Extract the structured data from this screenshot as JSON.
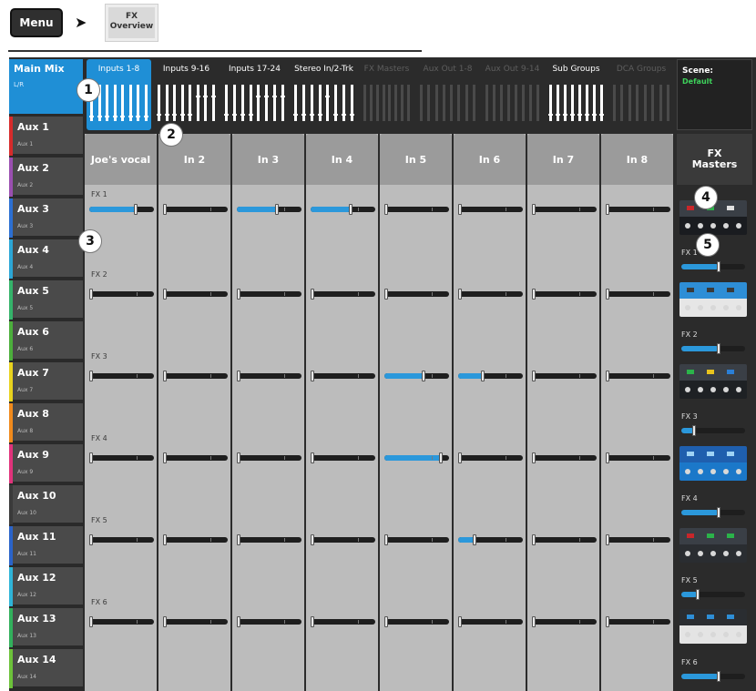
{
  "breadcrumb": {
    "menu": "Menu",
    "fx_line1": "FX",
    "fx_line2": "Overview"
  },
  "sidebar": {
    "main_mix": {
      "label": "Main Mix",
      "sub": "L/R"
    },
    "aux": [
      {
        "label": "Aux 1",
        "sub": "Aux 1",
        "color": "#d62b2b"
      },
      {
        "label": "Aux 2",
        "sub": "Aux 2",
        "color": "#9a4fb0"
      },
      {
        "label": "Aux 3",
        "sub": "Aux 3",
        "color": "#2c6fd2"
      },
      {
        "label": "Aux 4",
        "sub": "Aux 4",
        "color": "#2ca6d6"
      },
      {
        "label": "Aux 5",
        "sub": "Aux 5",
        "color": "#35b36a"
      },
      {
        "label": "Aux 6",
        "sub": "Aux 6",
        "color": "#4caf3c"
      },
      {
        "label": "Aux 7",
        "sub": "Aux 7",
        "color": "#e8d21e"
      },
      {
        "label": "Aux 8",
        "sub": "Aux 8",
        "color": "#f08a1c"
      },
      {
        "label": "Aux 9",
        "sub": "Aux 9",
        "color": "#e0337b"
      },
      {
        "label": "Aux 10",
        "sub": "Aux 10",
        "color": "#3a3a3a"
      },
      {
        "label": "Aux 11",
        "sub": "Aux 11",
        "color": "#2a63c9"
      },
      {
        "label": "Aux 12",
        "sub": "Aux 12",
        "color": "#2fb4d8"
      },
      {
        "label": "Aux 13",
        "sub": "Aux 13",
        "color": "#32b05c"
      },
      {
        "label": "Aux 14",
        "sub": "Aux 14",
        "color": "#6cc23a"
      }
    ]
  },
  "tabs": [
    {
      "label": "Inputs 1-8",
      "state": "active"
    },
    {
      "label": "Inputs 9-16",
      "state": "normal"
    },
    {
      "label": "Inputs 17-24",
      "state": "normal"
    },
    {
      "label": "Stereo In/2-Trk",
      "state": "normal"
    },
    {
      "label": "FX Masters",
      "state": "disabled"
    },
    {
      "label": "Aux Out 1-8",
      "state": "disabled"
    },
    {
      "label": "Aux Out 9-14",
      "state": "disabled"
    },
    {
      "label": "Sub Groups",
      "state": "normal"
    },
    {
      "label": "DCA Groups",
      "state": "disabled"
    }
  ],
  "scene": {
    "label": "Scene:",
    "name": "Default"
  },
  "channels": [
    "Joe's vocal",
    "In 2",
    "In 3",
    "In 4",
    "In 5",
    "In 6",
    "In 7",
    "In 8"
  ],
  "send_labels": [
    "FX 1",
    "FX 2",
    "FX 3",
    "FX 4",
    "FX 5",
    "FX 6"
  ],
  "send_levels": [
    [
      0.72,
      0.0,
      0.62,
      0.62,
      0.0,
      0.0,
      0.0,
      0.0
    ],
    [
      0.0,
      0.0,
      0.0,
      0.0,
      0.0,
      0.0,
      0.0,
      0.0
    ],
    [
      0.0,
      0.0,
      0.0,
      0.0,
      0.6,
      0.38,
      0.0,
      0.0
    ],
    [
      0.0,
      0.0,
      0.0,
      0.0,
      0.88,
      0.0,
      0.0,
      0.0
    ],
    [
      0.0,
      0.0,
      0.0,
      0.0,
      0.0,
      0.26,
      0.0,
      0.0
    ],
    [
      0.0,
      0.0,
      0.0,
      0.0,
      0.0,
      0.0,
      0.0,
      0.0
    ]
  ],
  "fx_masters": {
    "title_line1": "FX",
    "title_line2": "Masters",
    "items": [
      {
        "label": "FX 1",
        "level": 0.58,
        "thumb": "dark-red"
      },
      {
        "label": "FX 2",
        "level": 0.58,
        "thumb": "blue-white"
      },
      {
        "label": "FX 3",
        "level": 0.2,
        "thumb": "dark-multi"
      },
      {
        "label": "FX 4",
        "level": 0.58,
        "thumb": "blue-knobs"
      },
      {
        "label": "FX 5",
        "level": 0.26,
        "thumb": "red-green"
      },
      {
        "label": "FX 6",
        "level": 0.58,
        "thumb": "silver"
      }
    ]
  },
  "callouts": [
    "1",
    "2",
    "3",
    "4",
    "5"
  ],
  "colors": {
    "accent": "#1f8fd6",
    "fader_fill": "#2b98db",
    "strip_bg": "#bcbcbc",
    "strip_head": "#9b9b9b",
    "scene_name": "#3ed35b"
  }
}
